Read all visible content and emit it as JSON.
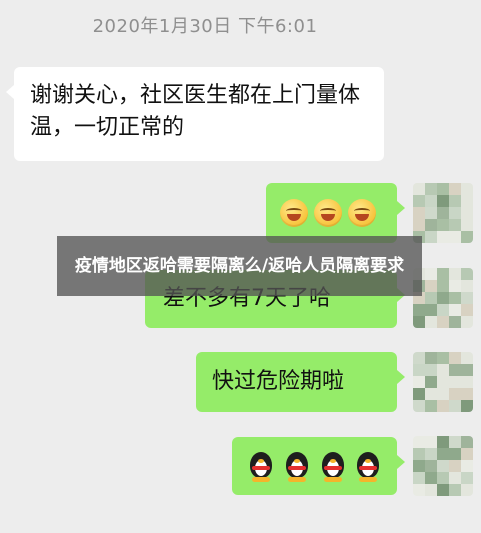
{
  "chat": {
    "timestamp": "2020年1月30日 下午6:01",
    "messages": [
      {
        "side": "left",
        "text": "谢谢关心，社区医生都在上门量体温，一切正常的"
      },
      {
        "side": "right",
        "type": "emoji",
        "emoji": "smile-icon",
        "count": 3
      },
      {
        "side": "right",
        "text": "差不多有7天了哈"
      },
      {
        "side": "right",
        "text": "快过危险期啦"
      },
      {
        "side": "right",
        "type": "emoji",
        "emoji": "penguin-icon",
        "count": 4
      }
    ]
  },
  "overlay": {
    "headline": "疫情地区返哈需要隔离么/返哈人员隔离要求"
  },
  "colors": {
    "background": "#ededed",
    "incoming_bubble": "#ffffff",
    "outgoing_bubble": "#95ec69",
    "overlay": "#555555"
  }
}
